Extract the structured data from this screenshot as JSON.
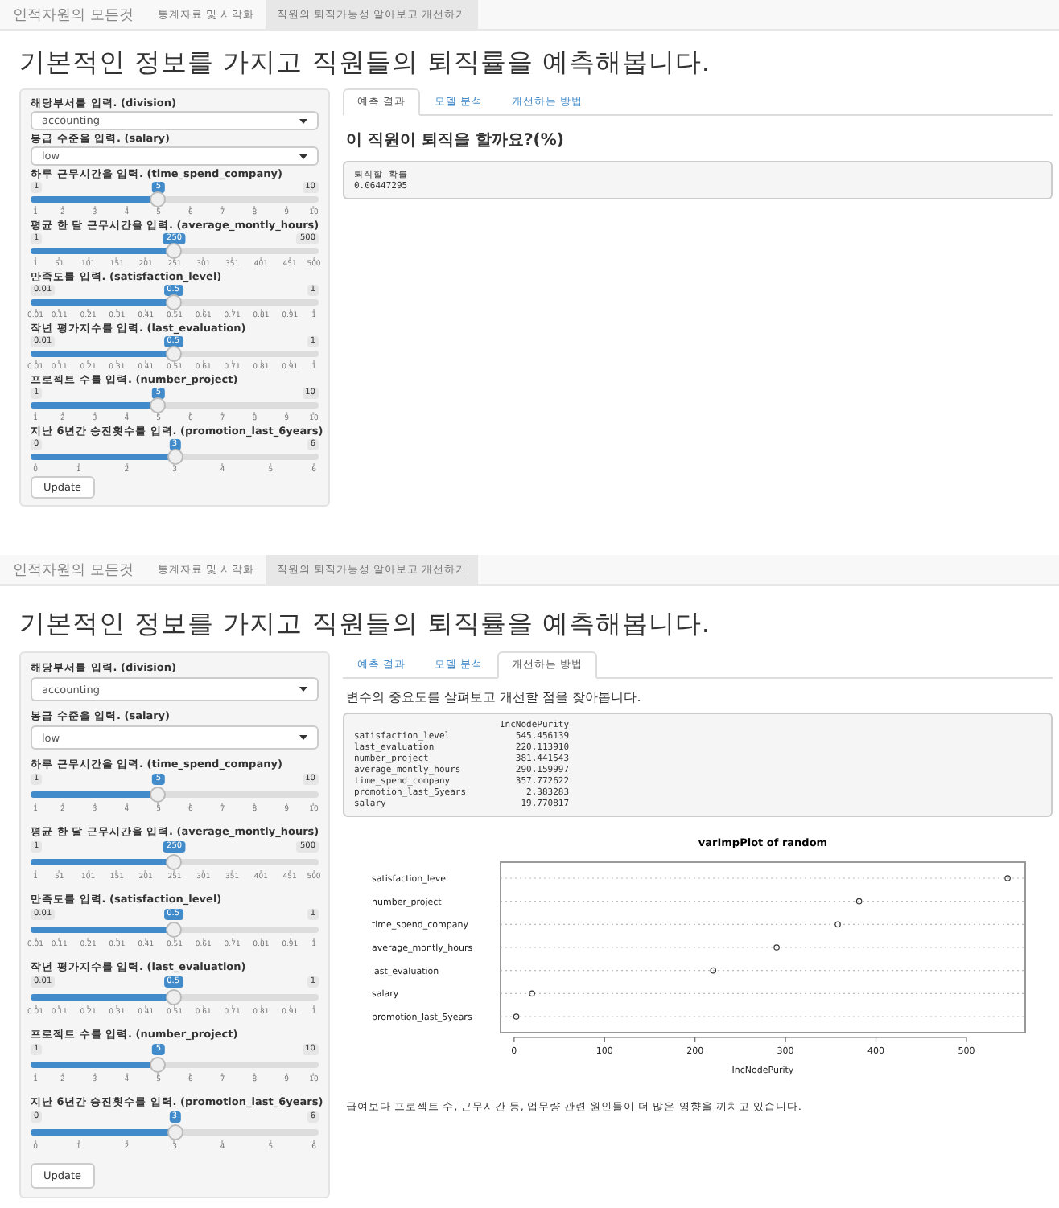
{
  "screens": [
    {
      "navbar": {
        "brand": "인적자원의 모든것",
        "tabs": [
          {
            "label": "통계자료 및 시각화",
            "selected": false
          },
          {
            "label": "직원의 퇴직가능성 알아보고 개선하기",
            "selected": true
          }
        ]
      },
      "heading": "기본적인 정보를 가지고 직원들의 퇴직률을 예측해봅니다.",
      "sidebar": {
        "selects": [
          {
            "label": "해당부서를 입력. (division)",
            "value": "accounting"
          },
          {
            "label": "봉급 수준을 입력. (salary)",
            "value": "low"
          }
        ],
        "sliders": [
          {
            "label": "하루 근무시간을 입력. (time_spend_company)",
            "min": "1",
            "max": "10",
            "value": "5",
            "level": 0.444,
            "ticks": [
              "1",
              "2",
              "3",
              "4",
              "5",
              "6",
              "7",
              "8",
              "9",
              "10"
            ]
          },
          {
            "label": "평균 한 달 근무시간을 입력. (average_montly_hours)",
            "min": "1",
            "max": "500",
            "value": "250",
            "level": 0.499,
            "ticks": [
              "1",
              "51",
              "101",
              "151",
              "201",
              "251",
              "301",
              "351",
              "401",
              "451",
              "500"
            ]
          },
          {
            "label": "만족도를 입력. (satisfaction_level)",
            "min": "0.01",
            "max": "1",
            "value": "0.5",
            "level": 0.495,
            "ticks": [
              "0.01",
              "0.11",
              "0.21",
              "0.31",
              "0.41",
              "0.51",
              "0.61",
              "0.71",
              "0.81",
              "0.91",
              "1"
            ]
          },
          {
            "label": "작년 평가지수를 입력. (last_evaluation)",
            "min": "0.01",
            "max": "1",
            "value": "0.5",
            "level": 0.495,
            "ticks": [
              "0.01",
              "0.11",
              "0.21",
              "0.31",
              "0.41",
              "0.51",
              "0.61",
              "0.71",
              "0.81",
              "0.91",
              "1"
            ]
          },
          {
            "label": "프로젝트 수를 입력. (number_project)",
            "min": "1",
            "max": "10",
            "value": "5",
            "level": 0.444,
            "ticks": [
              "1",
              "2",
              "3",
              "4",
              "5",
              "6",
              "7",
              "8",
              "9",
              "10"
            ]
          },
          {
            "label": "지난 6년간 승진횟수를 입력. (promotion_last_6years)",
            "min": "0",
            "max": "6",
            "value": "3",
            "level": 0.5,
            "ticks": [
              "0",
              "1",
              "2",
              "3",
              "4",
              "5",
              "6"
            ]
          }
        ],
        "button": "Update"
      },
      "tabs": [
        {
          "label": "예측 결과",
          "selected": true
        },
        {
          "label": "모델 분석",
          "selected": false
        },
        {
          "label": "개선하는 방법",
          "selected": false
        }
      ],
      "content": {
        "kind": "result",
        "title": "이 직원이 퇴직을 할까요?(%)",
        "output_label": "퇴직할 확률",
        "output_value": "0.06447295"
      }
    },
    {
      "navbar": {
        "brand": "인적자원의 모든것",
        "tabs": [
          {
            "label": "통계자료 및 시각화",
            "selected": false
          },
          {
            "label": "직원의 퇴직가능성 알아보고 개선하기",
            "selected": true
          }
        ]
      },
      "heading": "기본적인 정보를 가지고 직원들의 퇴직률을 예측해봅니다.",
      "sidebar": {
        "selects": [
          {
            "label": "해당부서를 입력. (division)",
            "value": "accounting"
          },
          {
            "label": "봉급 수준을 입력. (salary)",
            "value": "low"
          }
        ],
        "sliders": [
          {
            "label": "하루 근무시간을 입력. (time_spend_company)",
            "min": "1",
            "max": "10",
            "value": "5",
            "level": 0.444,
            "ticks": [
              "1",
              "2",
              "3",
              "4",
              "5",
              "6",
              "7",
              "8",
              "9",
              "10"
            ]
          },
          {
            "label": "평균 한 달 근무시간을 입력. (average_montly_hours)",
            "min": "1",
            "max": "500",
            "value": "250",
            "level": 0.499,
            "ticks": [
              "1",
              "51",
              "101",
              "151",
              "201",
              "251",
              "301",
              "351",
              "401",
              "451",
              "500"
            ]
          },
          {
            "label": "만족도를 입력. (satisfaction_level)",
            "min": "0.01",
            "max": "1",
            "value": "0.5",
            "level": 0.495,
            "ticks": [
              "0.01",
              "0.11",
              "0.21",
              "0.31",
              "0.41",
              "0.51",
              "0.61",
              "0.71",
              "0.81",
              "0.91",
              "1"
            ]
          },
          {
            "label": "작년 평가지수를 입력. (last_evaluation)",
            "min": "0.01",
            "max": "1",
            "value": "0.5",
            "level": 0.495,
            "ticks": [
              "0.01",
              "0.11",
              "0.21",
              "0.31",
              "0.41",
              "0.51",
              "0.61",
              "0.71",
              "0.81",
              "0.91",
              "1"
            ]
          },
          {
            "label": "프로젝트 수를 입력. (number_project)",
            "min": "1",
            "max": "10",
            "value": "5",
            "level": 0.444,
            "ticks": [
              "1",
              "2",
              "3",
              "4",
              "5",
              "6",
              "7",
              "8",
              "9",
              "10"
            ]
          },
          {
            "label": "지난 6년간 승진횟수를 입력. (promotion_last_6years)",
            "min": "0",
            "max": "6",
            "value": "3",
            "level": 0.5,
            "ticks": [
              "0",
              "1",
              "2",
              "3",
              "4",
              "5",
              "6"
            ]
          }
        ],
        "button": "Update"
      },
      "tabs": [
        {
          "label": "예측 결과",
          "selected": false
        },
        {
          "label": "모델 분석",
          "selected": false
        },
        {
          "label": "개선하는 방법",
          "selected": true
        }
      ],
      "content": {
        "kind": "improve",
        "intro": "변수의 중요도를 살펴보고 개선할 점을 찾아봅니다.",
        "importance_table": {
          "header": "IncNodePurity",
          "rows": [
            {
              "name": "satisfaction_level",
              "value": "545.456139"
            },
            {
              "name": "last_evaluation",
              "value": "220.113910"
            },
            {
              "name": "number_project",
              "value": "381.441543"
            },
            {
              "name": "average_montly_hours",
              "value": "290.159997"
            },
            {
              "name": "time_spend_company",
              "value": "357.772622"
            },
            {
              "name": "promotion_last_5years",
              "value": "2.383283"
            },
            {
              "name": "salary",
              "value": "19.770817"
            }
          ]
        },
        "chart_data": {
          "type": "scatter",
          "title": "varImpPlot of random",
          "xlabel": "IncNodePurity",
          "categories": [
            "satisfaction_level",
            "number_project",
            "time_spend_company",
            "average_montly_hours",
            "last_evaluation",
            "salary",
            "promotion_last_5years"
          ],
          "values": [
            545.5,
            381.4,
            357.8,
            290.2,
            220.1,
            19.8,
            2.4
          ],
          "xlim": [
            -15,
            565
          ],
          "xticks": [
            0,
            100,
            200,
            300,
            400,
            500
          ],
          "grid": true,
          "orientation": "horizontal"
        },
        "conclusion": "급여보다 프로젝트 수, 근무시간 등, 업무량 관련 원인들이 더 많은 영향을 끼치고 있습니다."
      }
    }
  ]
}
